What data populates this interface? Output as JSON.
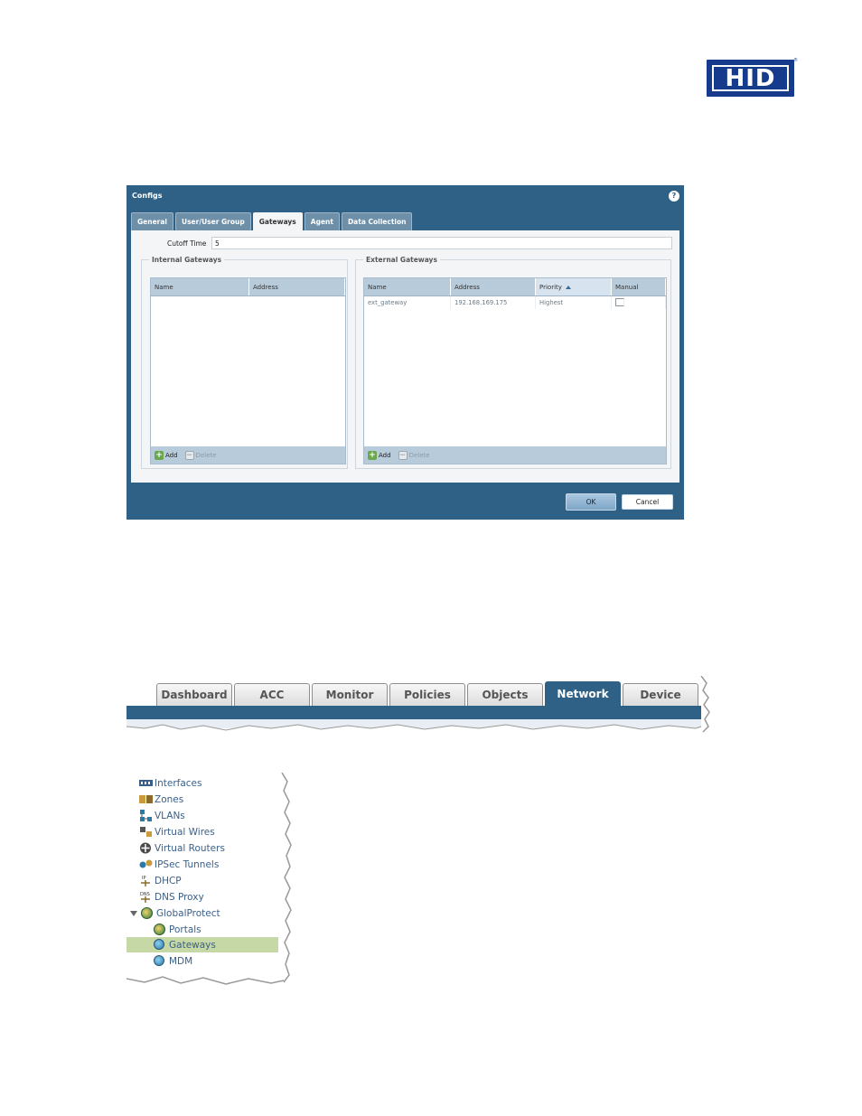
{
  "logo": {
    "text": "HID",
    "registered": "®",
    "color": "#163a8c"
  },
  "dialog": {
    "title": "Configs",
    "tabs": [
      "General",
      "User/User Group",
      "Gateways",
      "Agent",
      "Data Collection"
    ],
    "active_tab": "Gateways",
    "cutoff_label": "Cutoff Time",
    "cutoff_value": "5",
    "internal": {
      "legend": "Internal Gateways",
      "columns": [
        "Name",
        "Address"
      ],
      "add_label": "Add",
      "delete_label": "Delete"
    },
    "external": {
      "legend": "External Gateways",
      "columns": [
        "Name",
        "Address",
        "Priority",
        "Manual"
      ],
      "rows": [
        {
          "name": "ext_gateway",
          "address": "192.168.169.175",
          "priority": "Highest",
          "manual": false
        }
      ],
      "add_label": "Add",
      "delete_label": "Delete"
    },
    "ok_label": "OK",
    "cancel_label": "Cancel",
    "accent_color": "#2f6186"
  },
  "navbar": {
    "tabs": [
      "Dashboard",
      "ACC",
      "Monitor",
      "Policies",
      "Objects",
      "Network",
      "Device"
    ],
    "active_tab": "Network"
  },
  "tree": {
    "items": [
      {
        "label": "Interfaces",
        "icon": "interfaces-icon"
      },
      {
        "label": "Zones",
        "icon": "zones-icon"
      },
      {
        "label": "VLANs",
        "icon": "vlans-icon"
      },
      {
        "label": "Virtual Wires",
        "icon": "virtual-wires-icon"
      },
      {
        "label": "Virtual Routers",
        "icon": "virtual-routers-icon"
      },
      {
        "label": "IPSec Tunnels",
        "icon": "ipsec-tunnels-icon"
      },
      {
        "label": "DHCP",
        "icon": "dhcp-icon"
      },
      {
        "label": "DNS Proxy",
        "icon": "dns-proxy-icon"
      },
      {
        "label": "GlobalProtect",
        "icon": "globalprotect-icon"
      },
      {
        "label": "Portals",
        "icon": "portals-icon"
      },
      {
        "label": "Gateways",
        "icon": "gateways-icon"
      },
      {
        "label": "MDM",
        "icon": "mdm-icon"
      }
    ],
    "selected": "Gateways",
    "icon_badges": {
      "dhcp": "IP",
      "dns": "DNS"
    }
  }
}
